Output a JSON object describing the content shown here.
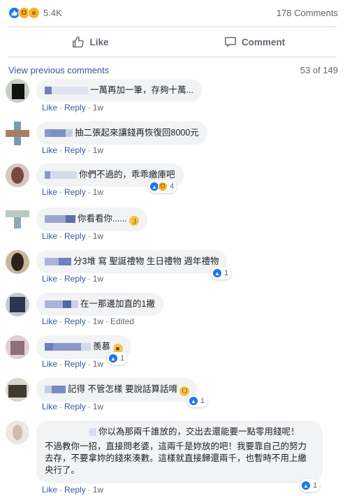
{
  "summary": {
    "reaction_icons": [
      "like-icon",
      "haha-icon",
      "wow-icon"
    ],
    "reaction_count": "5.4K",
    "comments_count": "178 Comments"
  },
  "actions": {
    "like": "Like",
    "comment": "Comment"
  },
  "thread": {
    "view_previous": "View previous comments",
    "pager": "53 of 149"
  },
  "colors": {
    "link": "#385898",
    "like_blue": "#1877f2",
    "bubble": "#f2f3f5",
    "muted": "#606770"
  },
  "comments": [
    {
      "text": "一萬再加一筆，存夠十萬...",
      "like": "Like",
      "reply": "Reply",
      "time": "1w"
    },
    {
      "text": "抽二張起來讓錢再恢復回8000元",
      "like": "Like",
      "reply": "Reply",
      "time": "1w"
    },
    {
      "text": "你們不過的，乖乖繳庫吧",
      "like": "Like",
      "reply": "Reply",
      "time": "1w",
      "reactions": "4"
    },
    {
      "text": "你看看你......",
      "emoji": "wink-emoji",
      "like": "Like",
      "reply": "Reply",
      "time": "1w"
    },
    {
      "text": "分3堆 寫 聖誕禮物 生日禮物 週年禮物",
      "like": "Like",
      "reply": "Reply",
      "time": "1w",
      "reactions": "1"
    },
    {
      "text": "在一那邊加直的1撇",
      "like": "Like",
      "reply": "Reply",
      "time": "1w",
      "edited": "Edited"
    },
    {
      "text": "羨慕",
      "emoji": "cool-emoji",
      "like": "Like",
      "reply": "Reply",
      "time": "1w",
      "reactions": "1"
    },
    {
      "text": "記得 不管怎樣 要說話算話唷",
      "emoji": "laugh-emoji",
      "like": "Like",
      "reply": "Reply",
      "time": "1w",
      "reactions": "1"
    },
    {
      "text_line1": "你以為那兩千誰放的，交出去還能要一點零用錢呢！",
      "text_body": "不過教你一招，直接問老婆，這兩千是妳放的吧！我要靠自己的努力去存，不要拿妳的錢來湊數。這樣就直接歸還兩千，也暫時不用上繳央行了。",
      "like": "Like",
      "reply": "Reply",
      "time": "1w",
      "reactions": "1"
    }
  ]
}
